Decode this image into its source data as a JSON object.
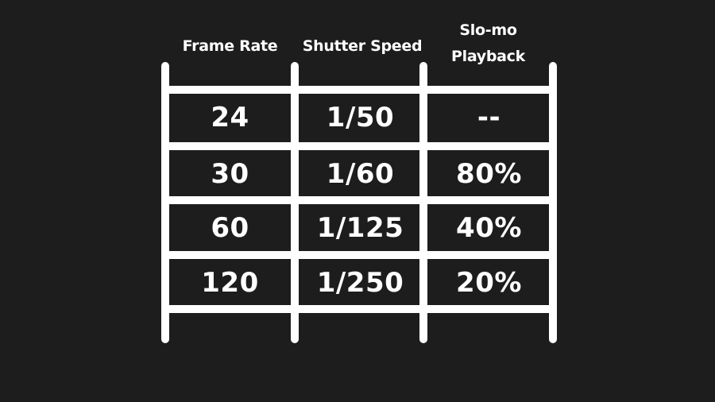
{
  "table": {
    "headers": [
      "Frame Rate",
      "Shutter Speed",
      "Slo-mo\nPlayback"
    ],
    "header_lines": {
      "col3_line1": "Slo-mo",
      "col3_line2": "Playback"
    },
    "rows": [
      [
        "24",
        "1/50",
        "--"
      ],
      [
        "30",
        "1/60",
        "80%"
      ],
      [
        "60",
        "1/125",
        "40%"
      ],
      [
        "120",
        "1/250",
        "20%"
      ]
    ]
  },
  "colors": {
    "background": "#1d1d1d",
    "lines": "#ffffff",
    "text": "#ffffff"
  }
}
